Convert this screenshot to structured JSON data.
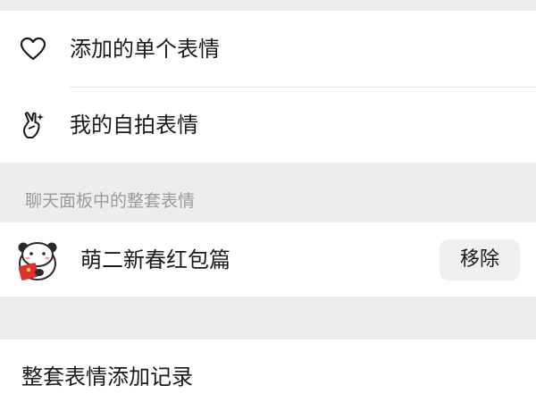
{
  "favorites": {
    "items": [
      {
        "label": "添加的单个表情",
        "icon": "heart-icon"
      },
      {
        "label": "我的自拍表情",
        "icon": "hand-gesture-icon"
      }
    ]
  },
  "sticker_section": {
    "title": "聊天面板中的整套表情",
    "packs": [
      {
        "name": "萌二新春红包篇",
        "thumbnail": "panda-red-envelope-sticker",
        "remove_label": "移除"
      }
    ]
  },
  "history": {
    "label": "整套表情添加记录"
  },
  "colors": {
    "background": "#ededed",
    "card": "#ffffff",
    "text": "#1a1a1a",
    "section_title": "#9b9b9b",
    "button_bg": "#efefef",
    "accent_red": "#d8332f"
  }
}
